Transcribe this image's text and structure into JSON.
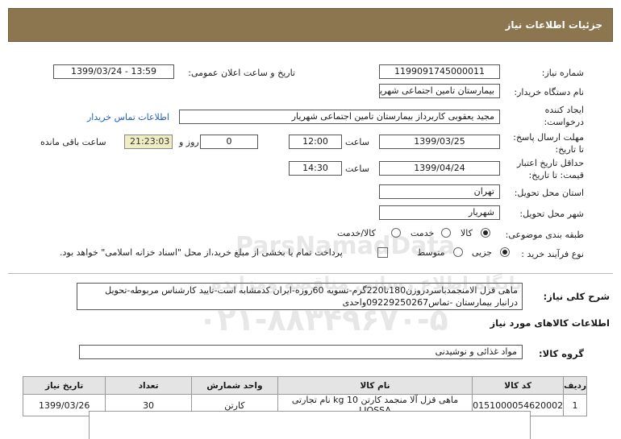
{
  "header": {
    "title": "جزئیات اطلاعات نیاز"
  },
  "fields": {
    "need_number_label": "شماره نیاز:",
    "need_number": "1199091745000011",
    "announce_label": "تاریخ و ساعت اعلان عمومی:",
    "announce_value": "1399/03/24 - 13:59",
    "buyer_label": "نام دستگاه خریدار:",
    "buyer": "بیمارستان تامین اجتماعی شهریار",
    "creator_label_1": "ایجاد کننده",
    "creator_label_2": "درخواست:",
    "creator": "مجید  یعقوبی کاربرداز بیمارستان تامین اجتماعی شهریار",
    "contact_link": "اطلاعات تماس خریدار",
    "deadline_label_1": "مهلت ارسال پاسخ:",
    "deadline_label_2": "تا تاریخ:",
    "deadline_date": "1399/03/25",
    "hour_label": "ساعت",
    "deadline_time": "12:00",
    "days_value": "0",
    "days_label": "روز و",
    "remaining_time": "21:23:03",
    "remaining_label": "ساعت باقی مانده",
    "validity_label_1": "حداقل تاریخ اعتبار",
    "validity_label_2": "قیمت: تا تاریخ:",
    "validity_date": "1399/04/24",
    "validity_time": "14:30",
    "province_label": "استان محل تحویل:",
    "province": "تهران",
    "city_label": "شهر محل تحویل:",
    "city": "شهریار",
    "category_label": "طبقه بندی موضوعی:",
    "category_options": [
      "کالا",
      "خدمت",
      "کالا/خدمت"
    ],
    "process_label": "نوع فرآیند خرید :",
    "process_options": [
      "جزیی",
      "متوسط"
    ],
    "payment_note": "پرداخت تمام یا بخشی از مبلغ خرید،از محل \"اسناد خزانه اسلامی\" خواهد بود.",
    "desc_label": "شرح کلی نیاز:",
    "desc": "ماهی قزل الامنجمدباسردروزن180تا220گرم-تسویه 60روزه-ایران کدمشابه است-تایید کارشناس مربوطه-تحویل درانبار بیمارستان -تماس09229250267واحدی"
  },
  "goods": {
    "section_title": "اطلاعات کالاهای مورد نیاز",
    "group_label": "گروه کالا:",
    "group": "مواد غذائی و نوشیدنی",
    "columns": [
      "ردیف",
      "کد کالا",
      "نام کالا",
      "واحد شمارش",
      "تعداد",
      "تاریخ نیاز"
    ],
    "rows": [
      [
        "1",
        "0151000054620002",
        "ماهی قزل آلا منجمد کارتن 10 kg نام تجارتی LIOSSA",
        "کارتن",
        "30",
        "1399/03/26"
      ]
    ]
  },
  "watermark": {
    "brand": "ParsNamadData",
    "line1": "پایگاه اطلاع رسانی مناقصه ومزایده",
    "phone": "۰۲۱-۸۸۳۴۹۶۷۰-۵"
  }
}
